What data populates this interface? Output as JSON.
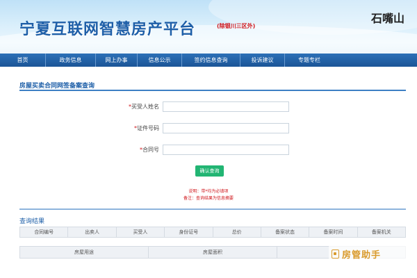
{
  "header": {
    "site_title": "宁夏互联网智慧房产平台",
    "site_subtitle": "(除银川三区外)",
    "region": "石嘴山"
  },
  "nav": {
    "items": [
      {
        "label": "首页"
      },
      {
        "label": "政务信息"
      },
      {
        "label": "网上办事"
      },
      {
        "label": "信息公示"
      },
      {
        "label": "签约信息查询"
      },
      {
        "label": "投诉建议"
      },
      {
        "label": "专题专栏"
      }
    ]
  },
  "query_form": {
    "title": "房屋买卖合同网签备案查询",
    "required_mark": "*",
    "fields": [
      {
        "label": "买受人姓名",
        "value": "",
        "placeholder": ""
      },
      {
        "label": "证件号码",
        "value": "",
        "placeholder": ""
      },
      {
        "label": "合同号",
        "value": "",
        "placeholder": ""
      }
    ],
    "submit_label": "确认查询",
    "note_1": "说明：带*均为必填项",
    "note_2": "备注：查询结果为信息摘要"
  },
  "results": {
    "title": "查询结果",
    "table1_headers": [
      "合同编号",
      "出卖人",
      "买受人",
      "身份证号",
      "总价",
      "备案状态",
      "备案时间",
      "备案机关"
    ],
    "table2_headers": [
      "房屋用途",
      "房屋面积",
      ""
    ]
  },
  "watermark": {
    "text": "房管助手",
    "icon": "house-manager-icon"
  },
  "colors": {
    "nav_bg": "#1f5e9e",
    "accent_blue": "#1e5fa8",
    "required_red": "#d0161b",
    "submit_green": "#22b573",
    "watermark_orange": "#d99a2b"
  }
}
